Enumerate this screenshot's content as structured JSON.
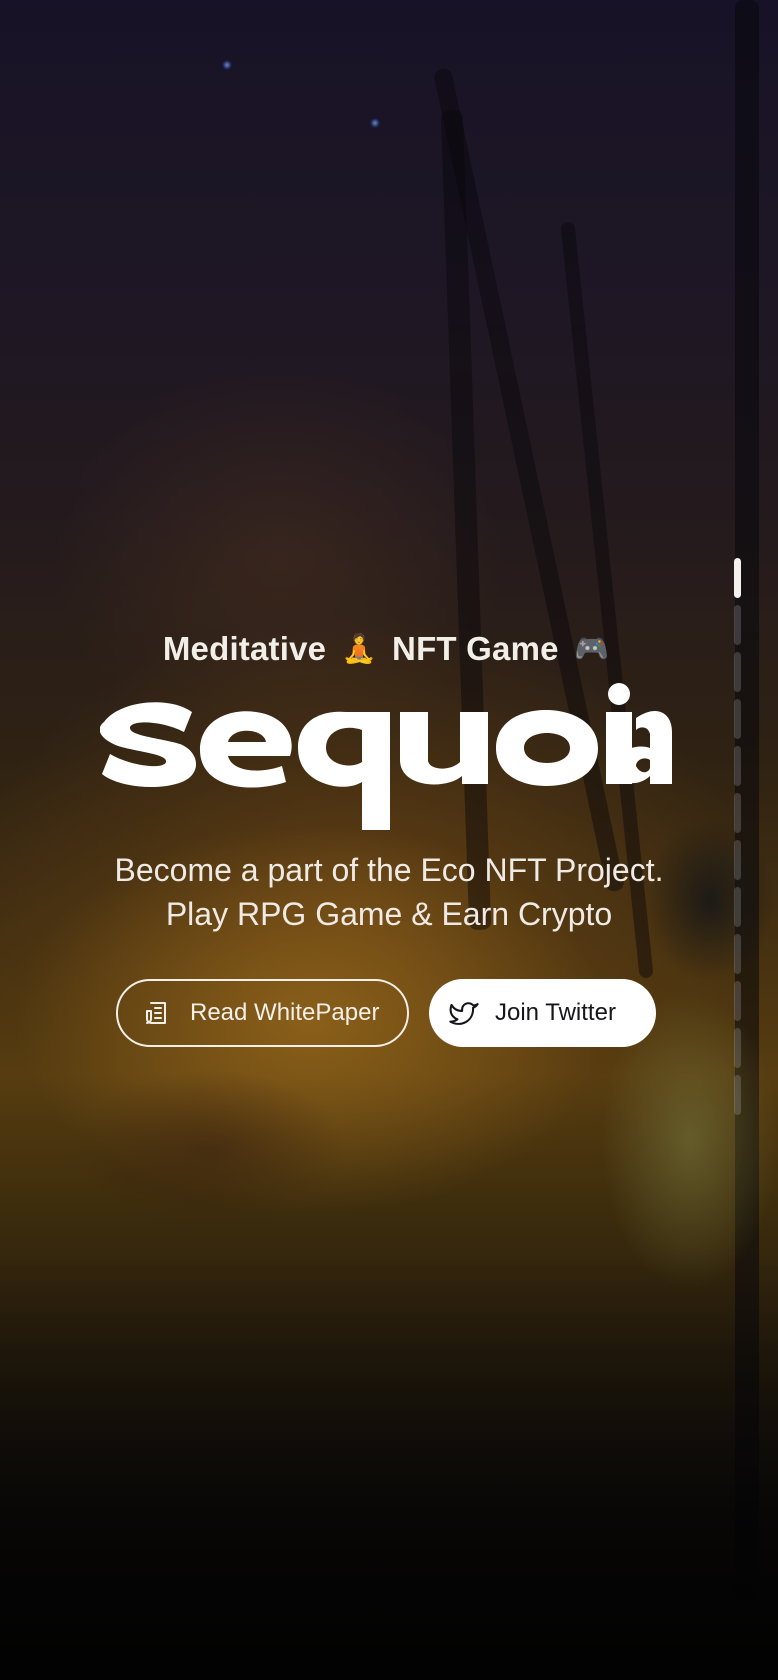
{
  "hero": {
    "tagline_prefix": "Meditative",
    "tagline_emoji_1": "🧘",
    "tagline_suffix": "NFT Game",
    "tagline_emoji_2": "🎮",
    "logo_text": "sequoia",
    "subtitle_line_1": "Become a part of the Eco NFT Project.",
    "subtitle_line_2": "Play RPG Game & Earn Crypto"
  },
  "actions": {
    "whitepaper_label": "Read WhitePaper",
    "whitepaper_icon": "document-icon",
    "twitter_label": "Join Twitter",
    "twitter_icon": "twitter-bird-icon"
  },
  "scroll_nav": {
    "sections": 12,
    "active_index": 0
  },
  "colors": {
    "text": "#f4f1ec",
    "button_solid_bg": "#ffffff",
    "button_solid_text": "#16151a",
    "accent_glow": "#d79628"
  }
}
